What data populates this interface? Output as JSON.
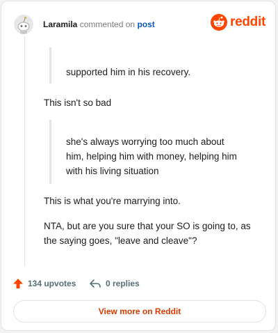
{
  "header": {
    "username": "Laramila",
    "action": "commented on",
    "link_text": "post",
    "brand": "reddit"
  },
  "comment": {
    "quote1": "supported him in his recovery.",
    "para1": "This isn't so bad",
    "quote2_lines": [
      "she's always worrying too much about",
      "him, helping him with money, helping him",
      "with his living situation"
    ],
    "para2": "This is what you're marrying into.",
    "para3_lines": [
      "NTA, but are you sure that your SO is going to, as",
      "the saying goes, \"leave and cleave\"?"
    ]
  },
  "footer": {
    "upvotes": "134 upvotes",
    "replies": "0 replies",
    "view_more": "View more on Reddit"
  },
  "colors": {
    "brand": "#ff4500",
    "link": "#0a59c3",
    "view_more": "#d93a00",
    "upvote": "#ff4500"
  },
  "icons": {
    "avatar": "snoo-avatar",
    "brand_logo": "reddit-snoo-icon",
    "upvote": "upvote-arrow-icon",
    "reply": "reply-arrow-icon"
  }
}
